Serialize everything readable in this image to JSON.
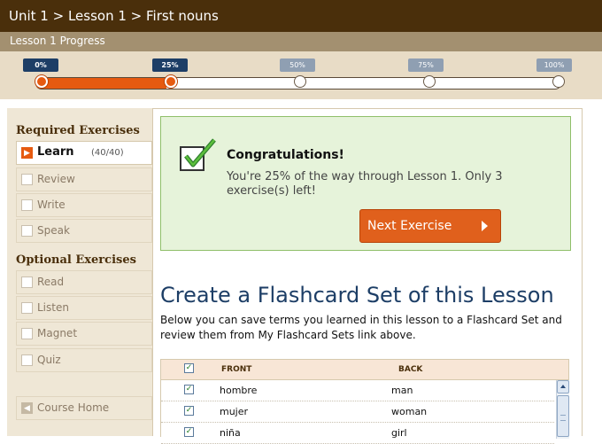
{
  "header": {
    "breadcrumb": "Unit 1 > Lesson 1 > First nouns",
    "progress_title": "Lesson 1 Progress"
  },
  "progress": {
    "value_percent": 25,
    "markers": [
      {
        "label": "0%",
        "reached": true
      },
      {
        "label": "25%",
        "reached": true
      },
      {
        "label": "50%",
        "reached": false
      },
      {
        "label": "75%",
        "reached": false
      },
      {
        "label": "100%",
        "reached": false
      }
    ]
  },
  "sidebar": {
    "required_heading": "Required Exercises",
    "required": [
      {
        "label": "Learn",
        "count": "(40/40)",
        "active": true
      },
      {
        "label": "Review"
      },
      {
        "label": "Write"
      },
      {
        "label": "Speak"
      }
    ],
    "optional_heading": "Optional Exercises",
    "optional": [
      {
        "label": "Read"
      },
      {
        "label": "Listen"
      },
      {
        "label": "Magnet"
      },
      {
        "label": "Quiz"
      }
    ],
    "course_home": "Course Home"
  },
  "congrats": {
    "title": "Congratulations!",
    "message": "You're 25% of the way through Lesson 1. Only 3 exercise(s) left!",
    "next_button": "Next Exercise"
  },
  "flashcards": {
    "title": "Create a Flashcard Set of this Lesson",
    "description": "Below you can save terms you learned in this lesson to a Flashcard Set and review them from My Flashcard Sets link above.",
    "col_front": "FRONT",
    "col_back": "BACK",
    "rows": [
      {
        "front": "hombre",
        "back": "man",
        "checked": true
      },
      {
        "front": "mujer",
        "back": "woman",
        "checked": true
      },
      {
        "front": "niña",
        "back": "girl",
        "checked": true
      }
    ]
  },
  "colors": {
    "header_bg": "#4a2f0b",
    "accent": "#e65a10",
    "marker_done": "#1d3e66",
    "success_bg": "#e6f3da"
  }
}
